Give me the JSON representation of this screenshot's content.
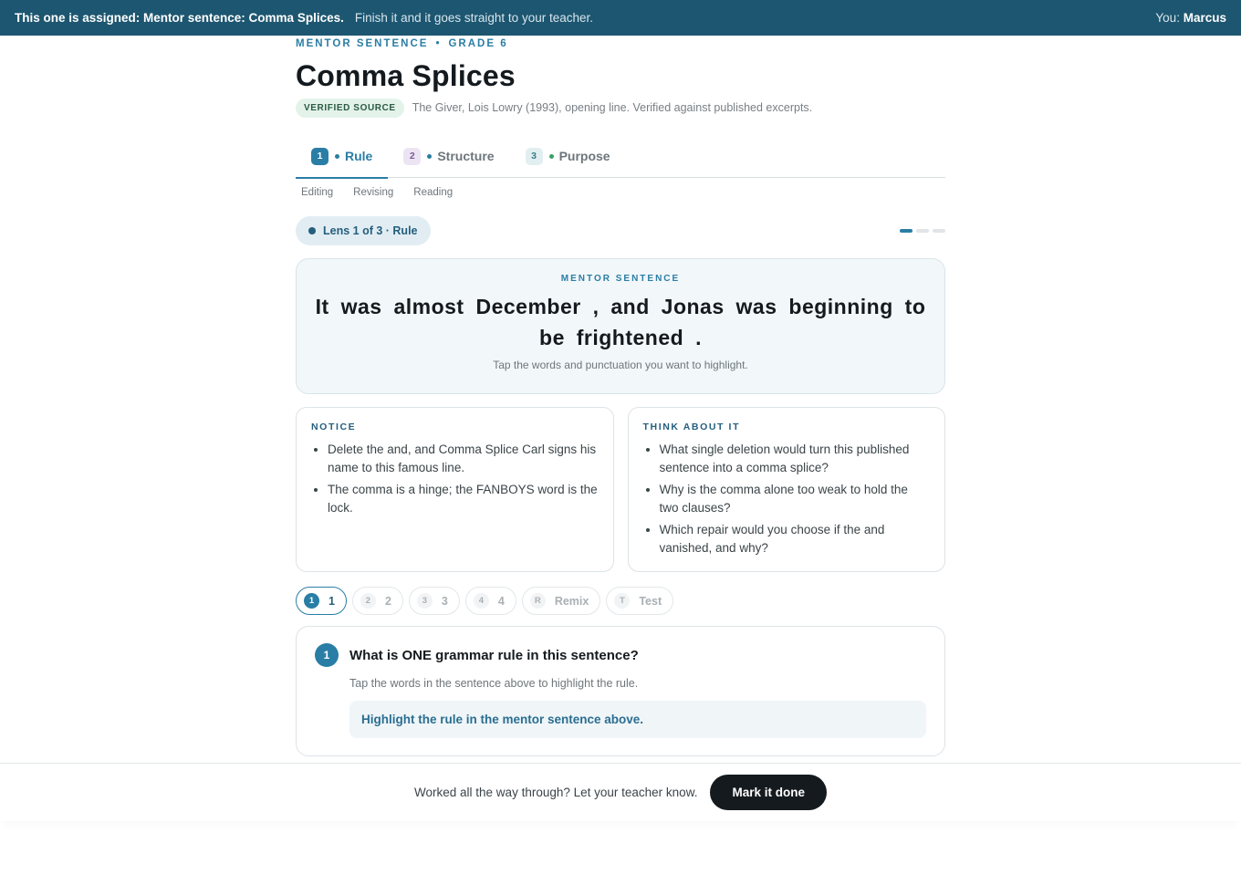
{
  "banner": {
    "assigned": "This one is assigned: Mentor sentence: Comma Splices.",
    "message": "Finish it and it goes straight to your teacher.",
    "you_label": "You:",
    "user_name": "Marcus"
  },
  "header": {
    "eyebrow_kind": "MENTOR SENTENCE",
    "eyebrow_sep": "•",
    "eyebrow_grade": "GRADE 6",
    "title": "Comma Splices",
    "verified_badge": "VERIFIED SOURCE",
    "source_text": "The Giver, Lois Lowry (1993), opening line. Verified against published excerpts."
  },
  "tabs": [
    {
      "num": "1",
      "label": "Rule",
      "dot_color": "#2a7ea5",
      "active": true
    },
    {
      "num": "2",
      "label": "Structure",
      "dot_color": "#2a7ea5",
      "active": false
    },
    {
      "num": "3",
      "label": "Purpose",
      "dot_color": "#3aa06a",
      "active": false
    }
  ],
  "subtabs": [
    "Editing",
    "Revising",
    "Reading"
  ],
  "lens": {
    "label": "Lens 1 of 3 · Rule",
    "current": 1,
    "total": 3
  },
  "mentor": {
    "label": "MENTOR SENTENCE",
    "tokens": [
      "It",
      "was",
      "almost",
      "December",
      ",",
      "and",
      "Jonas",
      "was",
      "beginning",
      "to",
      "be",
      "frightened",
      "."
    ],
    "hint": "Tap the words and punctuation you want to highlight."
  },
  "notice": {
    "heading": "NOTICE",
    "items": [
      "Delete the and, and Comma Splice Carl signs his name to this famous line.",
      "The comma is a hinge; the FANBOYS word is the lock."
    ]
  },
  "think": {
    "heading": "THINK ABOUT IT",
    "items": [
      "What single deletion would turn this published sentence into a comma splice?",
      "Why is the comma alone too weak to hold the two clauses?",
      "Which repair would you choose if the and vanished, and why?"
    ]
  },
  "question_steps": [
    {
      "badge": "1",
      "label": "1",
      "active": true
    },
    {
      "badge": "2",
      "label": "2",
      "active": false
    },
    {
      "badge": "3",
      "label": "3",
      "active": false
    },
    {
      "badge": "4",
      "label": "4",
      "active": false
    },
    {
      "badge": "R",
      "label": "Remix",
      "active": false
    },
    {
      "badge": "T",
      "label": "Test",
      "active": false
    }
  ],
  "question": {
    "num": "1",
    "title": "What is ONE grammar rule in this sentence?",
    "subtitle": "Tap the words in the sentence above to highlight the rule.",
    "answer_prompt": "Highlight the rule in the mentor sentence above."
  },
  "footer": {
    "text": "Worked all the way through? Let your teacher know.",
    "button": "Mark it done"
  }
}
